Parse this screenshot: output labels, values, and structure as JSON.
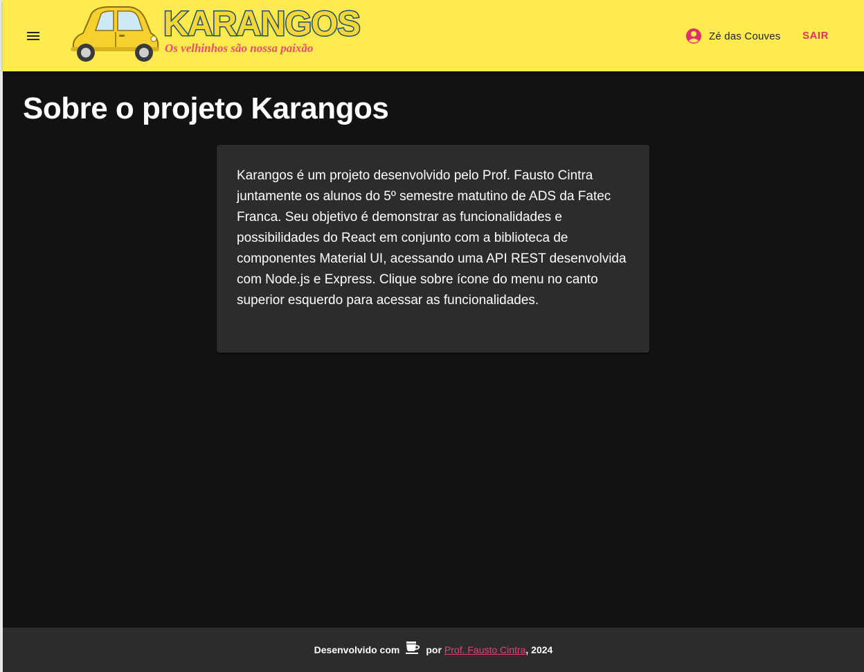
{
  "header": {
    "menu_icon": "hamburger-menu-icon",
    "logo_title": "KARANGOS",
    "logo_tagline": "Os velhinhos são nossa paixão",
    "user_name": "Zé das Couves",
    "user_icon": "account-circle-icon",
    "logout_label": "SAIR"
  },
  "main": {
    "title": "Sobre o projeto Karangos",
    "about_text": "Karangos é um projeto desenvolvido pelo Prof. Fausto Cintra juntamente os alunos do 5º semestre matutino de ADS da Fatec Franca. Seu objetivo é demonstrar as funcionalidades e possibilidades do React em conjunto com a biblioteca de componentes Material UI, acessando uma API REST desenvolvida com Node.js e Express. Clique sobre ícone do menu no canto superior esquerdo para acessar as funcionalidades."
  },
  "footer": {
    "prefix": "Desenvolvido com",
    "icon": "coffee-cup-icon",
    "by": "por",
    "author_link": "Prof. Fausto Cintra",
    "suffix": ", 2024"
  },
  "colors": {
    "appbar": "#ffeb4f",
    "accent": "#e0306a",
    "background": "#121212",
    "card": "#2c2c2c"
  }
}
